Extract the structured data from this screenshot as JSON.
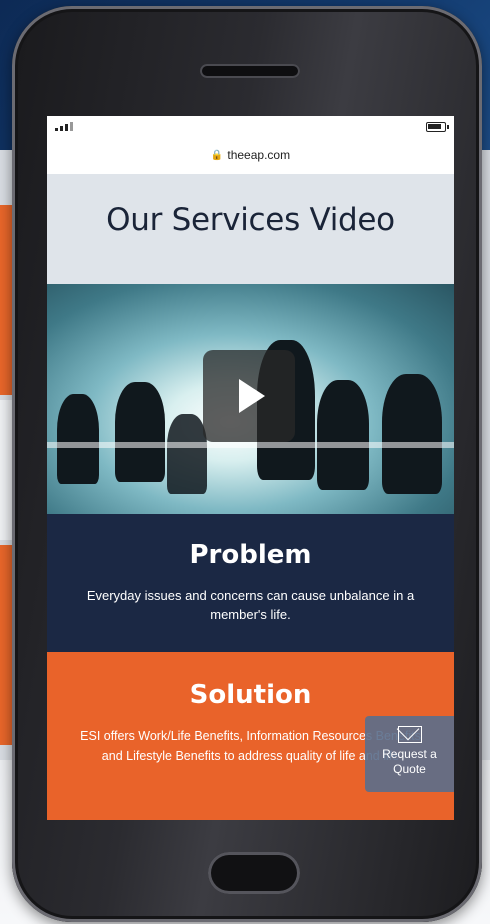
{
  "browser": {
    "url": "theeap.com"
  },
  "page": {
    "title": "Our Services Video",
    "video": {
      "play_label": "Play video"
    },
    "problem": {
      "heading": "Problem",
      "text": "Everyday issues and concerns can cause unbalance in a member's life."
    },
    "solution": {
      "heading": "Solution",
      "text": "ESI offers Work/Life Benefits, Information Resources Benefits and Lifestyle Benefits to address quality of life and life"
    },
    "quote_button": {
      "label": "Request a Quote"
    }
  },
  "colors": {
    "navy": "#1b2844",
    "orange": "#e9632a",
    "quote_bg": "#5a6e8c"
  }
}
